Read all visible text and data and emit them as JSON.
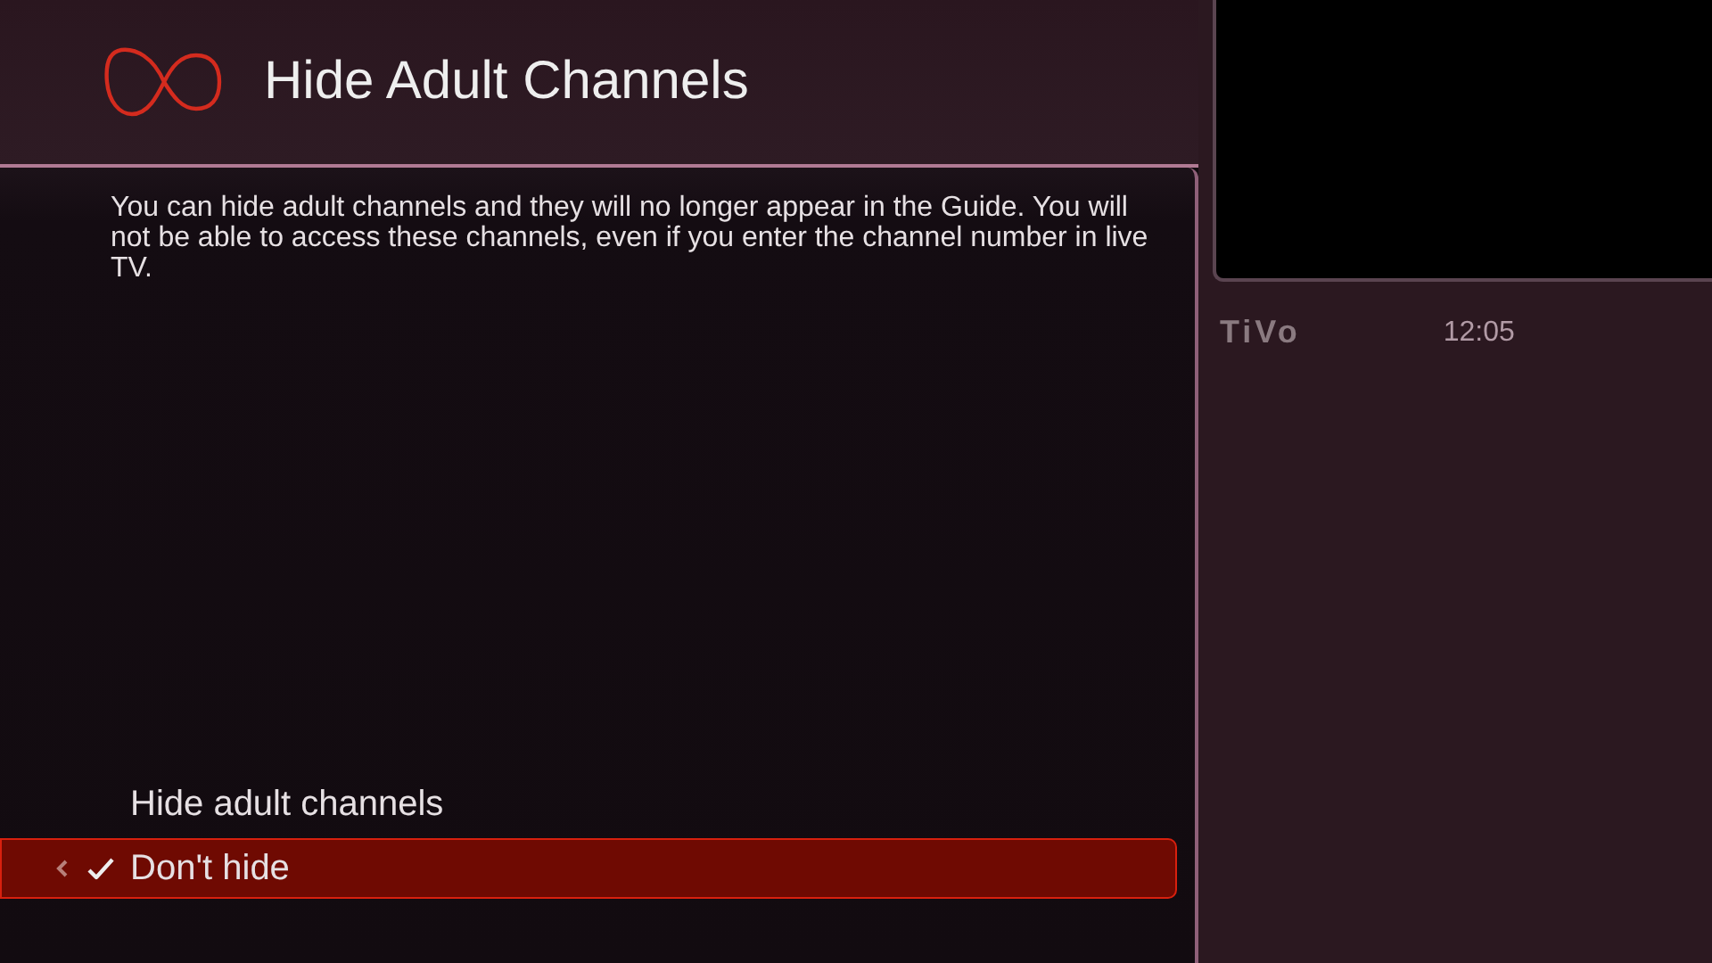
{
  "header": {
    "title": "Hide Adult Channels"
  },
  "description": "You can hide adult channels and they will no longer appear in the Guide. You will not be able to access these channels, even if you enter the channel number in live TV.",
  "options": [
    {
      "label": "Hide adult channels",
      "selected": false,
      "checked": false
    },
    {
      "label": "Don't hide",
      "selected": true,
      "checked": true
    }
  ],
  "side_panel": {
    "logo": "TiVo",
    "time": "12:05"
  }
}
